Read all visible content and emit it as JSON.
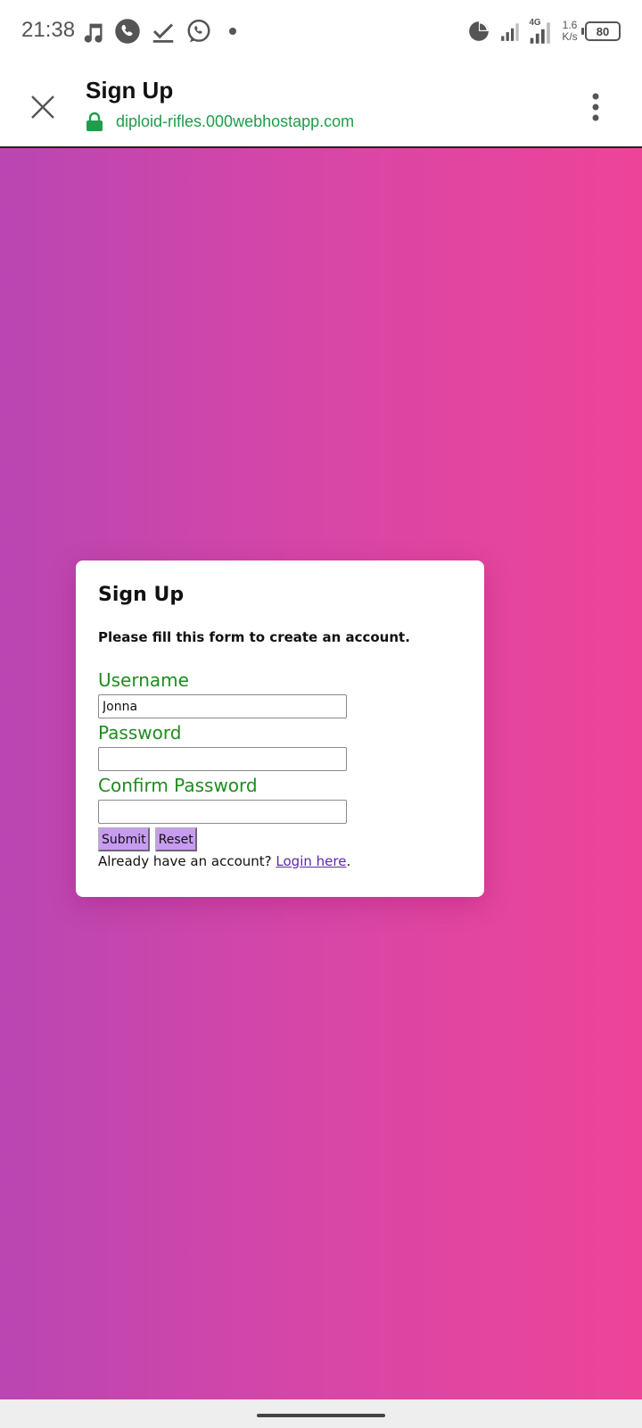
{
  "status_bar": {
    "time": "21:38",
    "net_speed_value": "1.6",
    "net_speed_unit": "K/s",
    "network_type": "4G",
    "battery": "80",
    "icons": [
      "music-icon",
      "phone-notification-icon",
      "download-done-icon",
      "whatsapp-icon",
      "dot-icon",
      "data-saver-icon",
      "signal-icon",
      "signal-4g-icon"
    ]
  },
  "toolbar": {
    "title": "Sign Up",
    "url": "diploid-rifles.000webhostapp.com",
    "url_color": "#1e9e4a"
  },
  "form": {
    "heading": "Sign Up",
    "subtitle": "Please fill this form to create an account.",
    "username_label": "Username",
    "username_value": "Jonna",
    "password_label": "Password",
    "password_value": "",
    "confirm_label": "Confirm Password",
    "confirm_value": "",
    "submit_label": "Submit",
    "reset_label": "Reset",
    "login_prefix": "Already have an account?",
    "login_link": "Login here",
    "login_suffix": ".",
    "label_color": "#1f8c1f",
    "button_color": "#c79cf0"
  },
  "colors": {
    "gradient_start": "#b946b2",
    "gradient_end": "#ee4498"
  }
}
